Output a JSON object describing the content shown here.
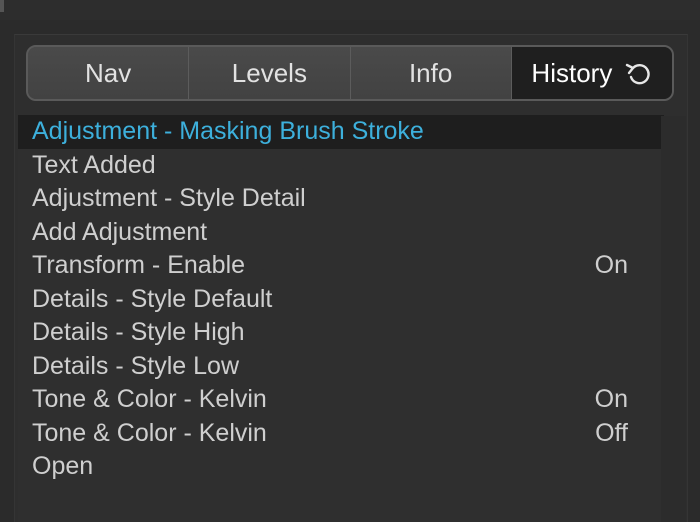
{
  "tabs": [
    {
      "label": "Nav",
      "active": false
    },
    {
      "label": "Levels",
      "active": false
    },
    {
      "label": "Info",
      "active": false
    },
    {
      "label": "History",
      "active": true,
      "icon": "undo-icon"
    }
  ],
  "history": {
    "items": [
      {
        "label": "Adjustment - Masking Brush Stroke",
        "state": "",
        "selected": true
      },
      {
        "label": "Text Added",
        "state": ""
      },
      {
        "label": "Adjustment - Style Detail",
        "state": ""
      },
      {
        "label": "Add Adjustment",
        "state": ""
      },
      {
        "label": "Transform - Enable",
        "state": "On"
      },
      {
        "label": "Details - Style Default",
        "state": ""
      },
      {
        "label": "Details - Style High",
        "state": ""
      },
      {
        "label": "Details - Style Low",
        "state": ""
      },
      {
        "label": "Tone & Color - Kelvin",
        "state": "On"
      },
      {
        "label": "Tone & Color - Kelvin",
        "state": "Off"
      },
      {
        "label": "Open",
        "state": ""
      }
    ]
  },
  "colors": {
    "selected_text": "#3db0dc",
    "normal_text": "#cfcfcf",
    "active_tab_bg": "#1f1f1f"
  }
}
